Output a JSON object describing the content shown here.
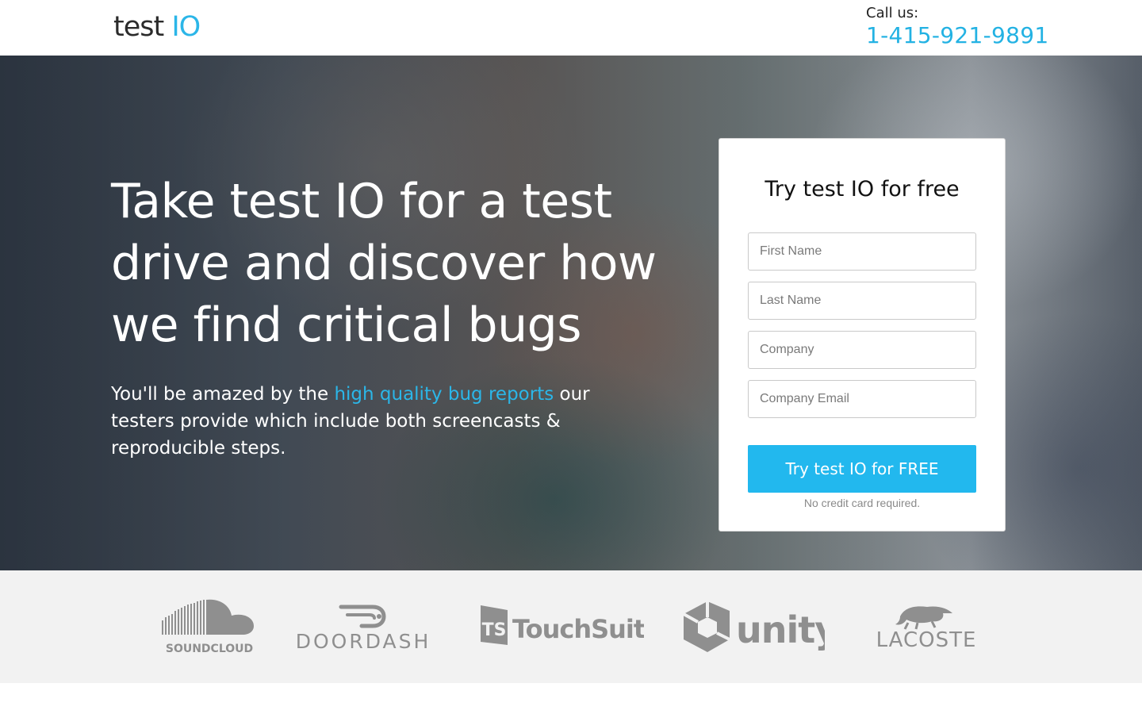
{
  "header": {
    "logo_part1": "test",
    "logo_part2": "IO",
    "callus_label": "Call us:",
    "phone": "1-415-921-9891"
  },
  "hero": {
    "headline": "Take test IO for a test drive and discover how we find critical bugs",
    "sub_before": "You'll be amazed by the ",
    "sub_link": "high quality bug reports",
    "sub_after": " our testers provide which include both screencasts & reproducible steps."
  },
  "form": {
    "title": "Try test IO for free",
    "first_name_placeholder": "First Name",
    "last_name_placeholder": "Last Name",
    "company_placeholder": "Company",
    "email_placeholder": "Company Email",
    "submit_label": "Try test IO for FREE",
    "note": "No credit card required."
  },
  "clients": {
    "soundcloud": "SOUNDCLOUD",
    "doordash": "DOORDASH",
    "touchsuite_mark": "TS",
    "touchsuite": "TouchSuite",
    "unity": "unity",
    "lacoste": "LACOSTE"
  },
  "colors": {
    "accent": "#22b8ee",
    "logo_gray": "#8f8f8f"
  }
}
